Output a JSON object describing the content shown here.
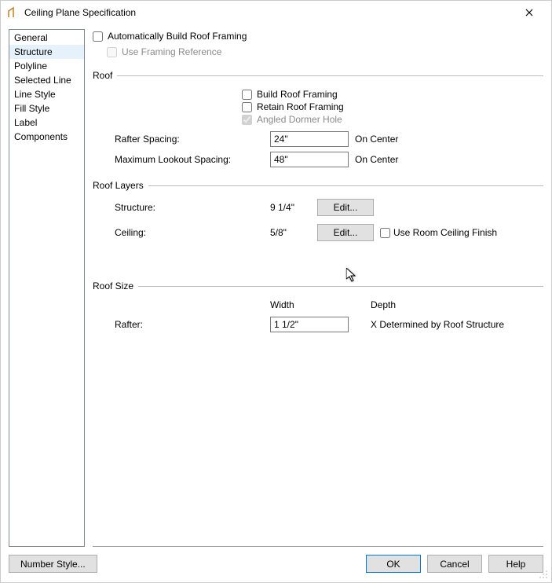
{
  "window": {
    "title": "Ceiling Plane Specification"
  },
  "sidebar": {
    "items": [
      {
        "label": "General"
      },
      {
        "label": "Structure"
      },
      {
        "label": "Polyline"
      },
      {
        "label": "Selected Line"
      },
      {
        "label": "Line Style"
      },
      {
        "label": "Fill Style"
      },
      {
        "label": "Label"
      },
      {
        "label": "Components"
      }
    ],
    "selectedIndex": 1
  },
  "framing": {
    "auto_label": "Automatically Build Roof Framing",
    "auto_checked": false,
    "use_ref_label": "Use Framing Reference",
    "use_ref_checked": false
  },
  "roof": {
    "header": "Roof",
    "build_label": "Build Roof Framing",
    "build_checked": false,
    "retain_label": "Retain Roof Framing",
    "retain_checked": false,
    "angled_label": "Angled Dormer Hole",
    "angled_checked": true,
    "rafter_spacing_label": "Rafter Spacing:",
    "rafter_spacing_value": "24\"",
    "rafter_spacing_suffix": "On Center",
    "max_lookout_label": "Maximum Lookout Spacing:",
    "max_lookout_value": "48\"",
    "max_lookout_suffix": "On Center"
  },
  "layers": {
    "header": "Roof Layers",
    "structure_label": "Structure:",
    "structure_value": "9 1/4\"",
    "ceiling_label": "Ceiling:",
    "ceiling_value": "5/8\"",
    "edit_label": "Edit...",
    "use_room_finish_label": "Use Room Ceiling Finish",
    "use_room_finish_checked": false
  },
  "size": {
    "header": "Roof Size",
    "width_label": "Width",
    "depth_label": "Depth",
    "rafter_label": "Rafter:",
    "rafter_width": "1 1/2\"",
    "rafter_depth": "X  Determined by Roof Structure"
  },
  "footer": {
    "number_style": "Number Style...",
    "ok": "OK",
    "cancel": "Cancel",
    "help": "Help"
  }
}
